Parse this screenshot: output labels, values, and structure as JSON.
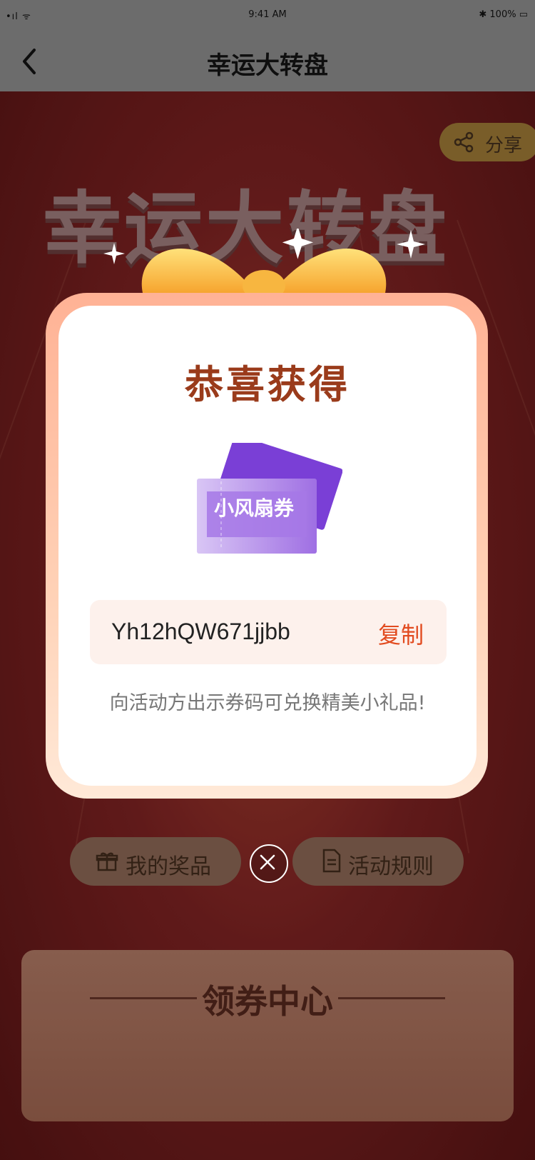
{
  "status_bar": {
    "signal": "•ıl ᯤ",
    "time": "9:41 AM",
    "battery": "100%"
  },
  "nav": {
    "title": "幸运大转盘",
    "back_icon": "chevron-left-icon"
  },
  "background": {
    "banner_title": "幸运大转盘",
    "share_label": "分享",
    "my_prizes_label": "我的奖品",
    "rules_label": "活动规则",
    "coupon_center_title": "领券中心"
  },
  "modal": {
    "title": "恭喜获得",
    "coupon_name": "小风扇券",
    "code": "Yh12hQW671jjbb",
    "copy_label": "复制",
    "hint": "向活动方出示券码可兑换精美小礼品!"
  },
  "colors": {
    "accent": "#e24b1f",
    "title_brown": "#9a3b1b",
    "coupon_purple": "#8f4fe0"
  }
}
